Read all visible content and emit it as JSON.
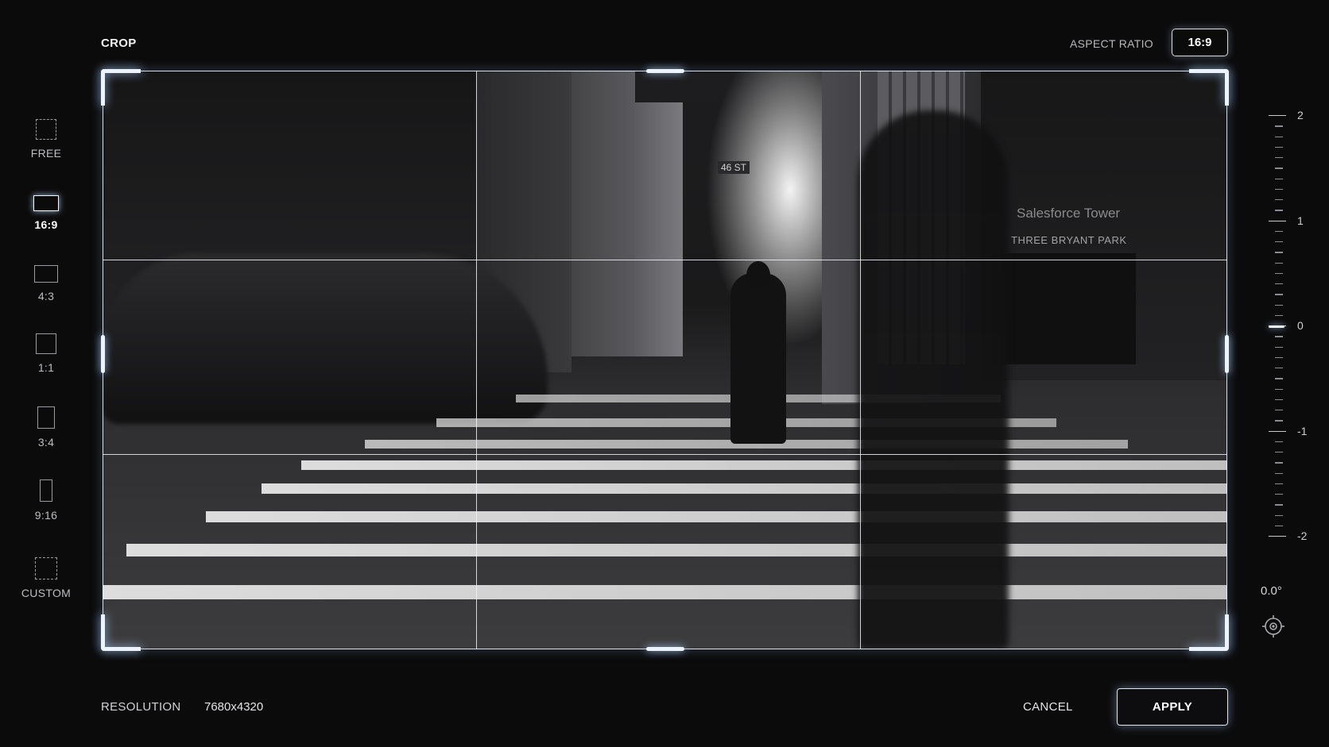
{
  "header": {
    "title": "CROP",
    "aspect_ratio_label": "ASPECT RATIO",
    "aspect_ratio_value": "16:9"
  },
  "ratios": [
    {
      "label": "FREE",
      "icon": "dashed-square-icon",
      "active": false
    },
    {
      "label": "16:9",
      "icon": "landscape-16-9-icon",
      "active": true
    },
    {
      "label": "4:3",
      "icon": "landscape-4-3-icon",
      "active": false
    },
    {
      "label": "1:1",
      "icon": "square-icon",
      "active": false
    },
    {
      "label": "3:4",
      "icon": "portrait-3-4-icon",
      "active": false
    },
    {
      "label": "9:16",
      "icon": "portrait-9-16-icon",
      "active": false
    },
    {
      "label": "CUSTOM",
      "icon": "dashed-custom-icon",
      "active": false
    }
  ],
  "photo": {
    "signs": [
      "Salesforce Tower",
      "THREE BRYANT PARK",
      "46 ST"
    ]
  },
  "rotation": {
    "labels": [
      "2",
      "1",
      "0",
      "-1",
      "-2"
    ],
    "value": "0.0°",
    "reset_icon": "reset-rotation-icon"
  },
  "footer": {
    "resolution_label": "RESOLUTION",
    "resolution_value": "7680x4320",
    "cancel_label": "CANCEL",
    "apply_label": "APPLY"
  },
  "colors": {
    "background": "#0b0b0c",
    "accent_glow": "#eef4ff"
  }
}
